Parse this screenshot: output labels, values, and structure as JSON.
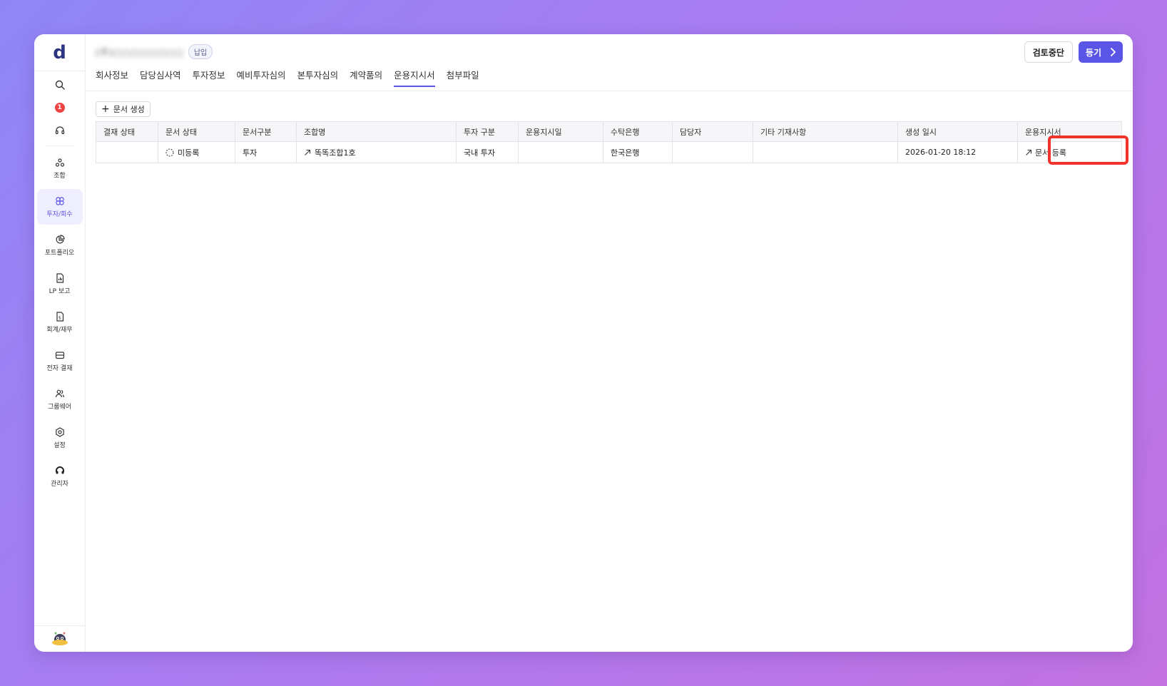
{
  "app": {
    "logo": "d"
  },
  "sidebar": {
    "notification_count": "1",
    "items": [
      {
        "label": "조합",
        "icon": "fund-icon"
      },
      {
        "label": "투자/회수",
        "icon": "investment-icon"
      },
      {
        "label": "포트폴리오",
        "icon": "portfolio-icon"
      },
      {
        "label": "LP 보고",
        "icon": "report-icon"
      },
      {
        "label": "회계/재무",
        "icon": "accounting-icon"
      },
      {
        "label": "전자 결재",
        "icon": "approval-icon"
      },
      {
        "label": "그룹웨어",
        "icon": "groupware-icon"
      },
      {
        "label": "설정",
        "icon": "settings-icon"
      },
      {
        "label": "관리자",
        "icon": "admin-icon"
      }
    ],
    "active_index": 1
  },
  "header": {
    "company_name": "(주)○○○○○○○○",
    "company_tag": "납입",
    "tabs": [
      "회사정보",
      "담당심사역",
      "투자정보",
      "예비투자심의",
      "본투자심의",
      "계약품의",
      "운용지시서",
      "첨부파일"
    ],
    "active_tab": 6,
    "stop_review_label": "검토중단",
    "register_label": "등기"
  },
  "toolbar": {
    "create_doc_label": "문서 생성"
  },
  "table": {
    "columns": [
      "결재 상태",
      "문서 상태",
      "문서구분",
      "조합명",
      "투자 구분",
      "운용지시일",
      "수탁은행",
      "담당자",
      "기타 기재사항",
      "생성 일시",
      "운용지시서"
    ],
    "rows": [
      {
        "approval_status": "",
        "doc_status": "미등록",
        "doc_type": "투자",
        "fund_name": "똑똑조합1호",
        "invest_type": "국내 투자",
        "instruction_date": "",
        "trustee_bank": "한국은행",
        "manager": "",
        "notes": "",
        "created_at": "2026-01-20 18:12",
        "instruction_doc": "문서 등록"
      }
    ]
  },
  "colors": {
    "accent": "#5b55e6",
    "highlight": "#f0332b",
    "alert": "#ef4444"
  }
}
